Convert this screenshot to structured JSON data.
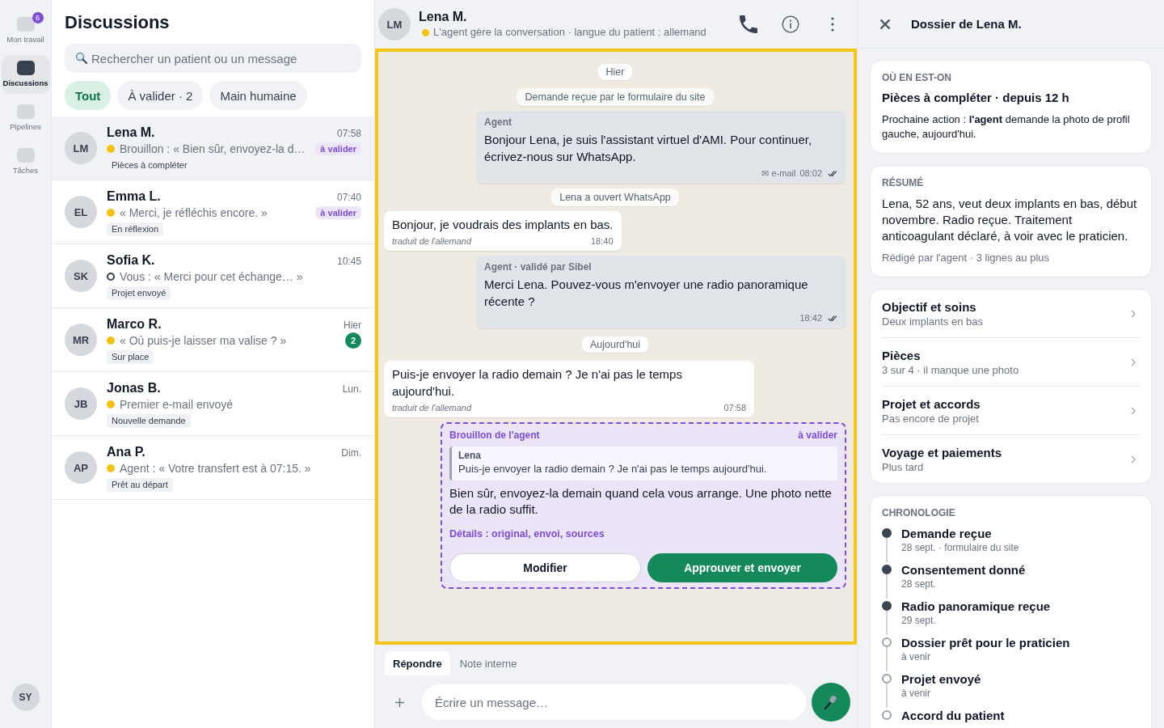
{
  "rail": {
    "items": [
      {
        "label": "Mon travail",
        "badge": "6",
        "selected": false
      },
      {
        "label": "Discussions",
        "selected": true
      },
      {
        "label": "Pipelines",
        "selected": false
      },
      {
        "label": "Tâches",
        "selected": false
      }
    ],
    "user_initials": "SY"
  },
  "list": {
    "title": "Discussions",
    "search": {
      "placeholder": "Rechercher un patient ou un message"
    },
    "filters": [
      {
        "label": "Tout",
        "selected": true
      },
      {
        "label": "À valider · 2",
        "selected": false
      },
      {
        "label": "Main humaine",
        "selected": false
      }
    ],
    "conversations": [
      {
        "initials": "LM",
        "name": "Lena M.",
        "time": "07:58",
        "agent_active": true,
        "preview": "Brouillon : « Bien sûr, envoyez-la d…",
        "review_label": "à valider",
        "tag": "Pièces à compléter",
        "selected": true
      },
      {
        "initials": "EL",
        "name": "Emma L.",
        "time": "07:40",
        "agent_active": true,
        "preview": "« Merci, je réfléchis encore. »",
        "review_label": "à valider",
        "tag": "En réflexion",
        "selected": false
      },
      {
        "initials": "SK",
        "name": "Sofia K.",
        "time": "10:45",
        "agent_active": false,
        "preview": "Vous : « Merci pour cet échange… »",
        "tag": "Projet envoyé",
        "selected": false
      },
      {
        "initials": "MR",
        "name": "Marco R.",
        "time": "Hier",
        "agent_active": true,
        "preview": "« Où puis-je laisser ma valise ? »",
        "unread": "2",
        "tag": "Sur place",
        "selected": false
      },
      {
        "initials": "JB",
        "name": "Jonas B.",
        "time": "Lun.",
        "agent_active": true,
        "preview": "Premier e-mail envoyé",
        "tag": "Nouvelle demande",
        "selected": false
      },
      {
        "initials": "AP",
        "name": "Ana P.",
        "time": "Dim.",
        "agent_active": true,
        "preview": "Agent : « Votre transfert est à 07:15. »",
        "tag": "Prêt au départ",
        "selected": false
      }
    ]
  },
  "chat": {
    "header": {
      "initials": "LM",
      "name": "Lena M.",
      "agent_active": true,
      "status": "L'agent gère la conversation · langue du patient : allemand"
    },
    "messages": [
      {
        "kind": "date",
        "text": "Hier"
      },
      {
        "kind": "system",
        "text": "Demande reçue par le formulaire du site"
      },
      {
        "kind": "outgoing",
        "sender": "Agent",
        "text": "Bonjour Lena, je suis l'assistant virtuel d'AMI. Pour continuer, écrivez-nous sur WhatsApp.",
        "channel": "✉ e-mail",
        "time": "08:02",
        "read": true
      },
      {
        "kind": "system",
        "text": "Lena a ouvert WhatsApp"
      },
      {
        "kind": "incoming",
        "text": "Bonjour, je voudrais des implants en bas.",
        "note": "traduit de l'allemand",
        "time": "18:40"
      },
      {
        "kind": "outgoing",
        "sender": "Agent · validé par Sibel",
        "text": "Merci Lena. Pouvez-vous m'envoyer une radio panoramique récente ?",
        "time": "18:42",
        "read": true
      },
      {
        "kind": "date",
        "text": "Aujourd'hui"
      },
      {
        "kind": "incoming",
        "text": "Puis-je envoyer la radio demain ? Je n'ai pas le temps aujourd'hui.",
        "note": "traduit de l'allemand",
        "time": "07:58"
      },
      {
        "kind": "draft",
        "title": "Brouillon de l'agent",
        "status": "à valider",
        "quote": {
          "author": "Lena",
          "text": "Puis-je envoyer la radio demain ? Je n'ai pas le temps aujourd'hui."
        },
        "text": "Bien sûr, envoyez-la demain quand cela vous arrange. Une photo nette de la radio suffit.",
        "details": "Détails : original, envoi, sources",
        "actions": [
          {
            "label": "Modifier",
            "kind": "secondary"
          },
          {
            "label": "Approuver et envoyer",
            "kind": "primary"
          }
        ]
      }
    ],
    "composer": {
      "tabs": [
        {
          "label": "Répondre",
          "selected": true
        },
        {
          "label": "Note interne",
          "selected": false
        }
      ],
      "placeholder": "Écrire un message…"
    }
  },
  "dossier": {
    "title": "Dossier de Lena M.",
    "status": {
      "label": "OÙ EN EST-ON",
      "title": "Pièces à compléter · depuis 12 h",
      "text": "Prochaine action : **l'agent** demande la photo de profil gauche, aujourd'hui."
    },
    "summary": {
      "label": "RÉSUMÉ",
      "text": "Lena, 52 ans, veut deux implants en bas, début novembre. Radio reçue. Traitement anticoagulant déclaré, à voir avec le praticien.",
      "footer": "Rédigé par l'agent · 3 lignes au plus"
    },
    "sections": [
      {
        "title": "Objectif et soins",
        "subtitle": "Deux implants en bas"
      },
      {
        "title": "Pièces",
        "subtitle": "3 sur 4 · il manque une photo"
      },
      {
        "title": "Projet et accords",
        "subtitle": "Pas encore de projet"
      },
      {
        "title": "Voyage et paiements",
        "subtitle": "Plus tard"
      }
    ],
    "timeline": {
      "label": "CHRONOLOGIE",
      "items": [
        {
          "title": "Demande reçue",
          "subtitle": "28 sept. · formulaire du site",
          "done": true
        },
        {
          "title": "Consentement donné",
          "subtitle": "28 sept.",
          "done": true
        },
        {
          "title": "Radio panoramique reçue",
          "subtitle": "29 sept.",
          "done": true
        },
        {
          "title": "Dossier prêt pour le praticien",
          "subtitle": "à venir",
          "done": false
        },
        {
          "title": "Projet envoyé",
          "subtitle": "à venir",
          "done": false
        },
        {
          "title": "Accord du patient",
          "done": false
        }
      ]
    }
  }
}
